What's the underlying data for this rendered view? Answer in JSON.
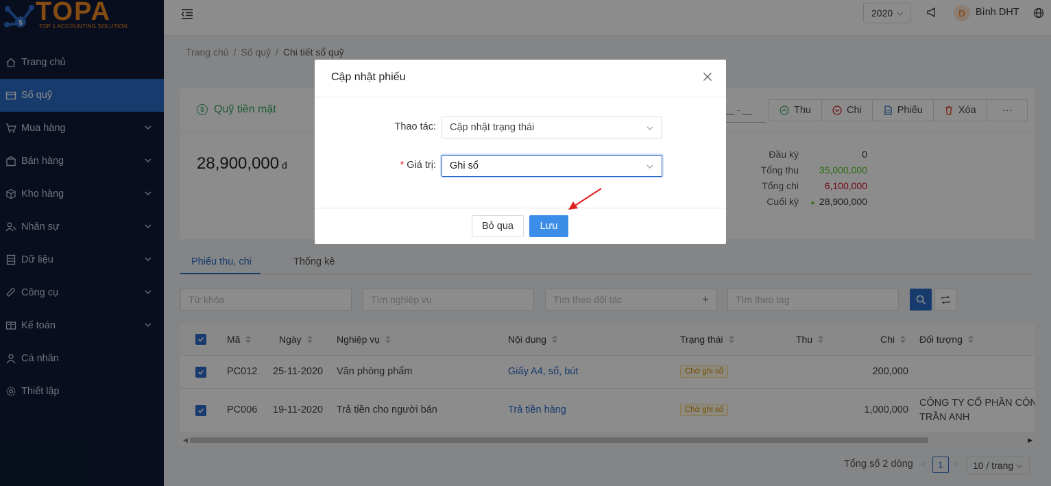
{
  "brand": {
    "name": "TOPA",
    "tagline": "TOP 1 ACCOUNTING SOLUTION",
    "color": "#f08a24"
  },
  "sidebar": {
    "items": [
      {
        "label": "Trang chủ",
        "icon": "home-icon",
        "expandable": false,
        "active": false
      },
      {
        "label": "Sổ quỹ",
        "icon": "wallet-icon",
        "expandable": false,
        "active": true
      },
      {
        "label": "Mua hàng",
        "icon": "cart-icon",
        "expandable": true,
        "active": false
      },
      {
        "label": "Bán hàng",
        "icon": "bag-icon",
        "expandable": true,
        "active": false
      },
      {
        "label": "Kho hàng",
        "icon": "box-icon",
        "expandable": true,
        "active": false
      },
      {
        "label": "Nhân sự",
        "icon": "people-icon",
        "expandable": true,
        "active": false
      },
      {
        "label": "Dữ liệu",
        "icon": "database-icon",
        "expandable": true,
        "active": false
      },
      {
        "label": "Công cụ",
        "icon": "tool-icon",
        "expandable": true,
        "active": false
      },
      {
        "label": "Kế toán",
        "icon": "ledger-icon",
        "expandable": true,
        "active": false
      },
      {
        "label": "Cá nhân",
        "icon": "user-icon",
        "expandable": false,
        "active": false
      },
      {
        "label": "Thiết lập",
        "icon": "gear-icon",
        "expandable": false,
        "active": false
      }
    ]
  },
  "header": {
    "year": "2020",
    "avatar_initial": "D",
    "username": "Bình DHT"
  },
  "breadcrumb": {
    "items": [
      "Trang chủ",
      "Sổ quỹ",
      "Chi tiết sổ quỹ"
    ]
  },
  "fund": {
    "title": "Quỹ tiền mặt",
    "date_fragment": "__ - __",
    "actions": [
      {
        "label": "Thu",
        "icon": "arrow-up-circle-icon"
      },
      {
        "label": "Chi",
        "icon": "arrow-down-circle-icon"
      },
      {
        "label": "Phiếu",
        "icon": "document-icon"
      },
      {
        "label": "Xóa",
        "icon": "trash-icon"
      },
      {
        "label": "···",
        "icon": "more-icon"
      }
    ],
    "balance": "28,900,000",
    "currency": "đ",
    "stats": [
      {
        "label": "Đầu kỳ",
        "value": "0",
        "tone": "default"
      },
      {
        "label": "Tổng thu",
        "value": "35,000,000",
        "tone": "green"
      },
      {
        "label": "Tổng chi",
        "value": "6,100,000",
        "tone": "red"
      },
      {
        "label": "Cuối kỳ",
        "value": "28,900,000",
        "tone": "up"
      }
    ]
  },
  "tabs": [
    "Phiếu thu, chi",
    "Thống kê"
  ],
  "filters": {
    "keyword_placeholder": "Từ khóa",
    "operation_placeholder": "Tìm nghiệp vụ",
    "partner_placeholder": "Tìm theo đối tác",
    "tag_placeholder": "Tìm theo tag"
  },
  "table": {
    "columns": [
      "Mã",
      "Ngày",
      "Nghiệp vụ",
      "Nội dung",
      "Trạng thái",
      "Thu",
      "Chi",
      "Đối tượng"
    ],
    "rows": [
      {
        "code": "PC012",
        "date": "25-11-2020",
        "operation": "Văn phòng phẩm",
        "content": "Giấy A4, sổ, bút",
        "status": "Chờ ghi sổ",
        "income": "",
        "expense": "200,000",
        "party_line1": "",
        "party_line2": ""
      },
      {
        "code": "PC006",
        "date": "19-11-2020",
        "operation": "Trả tiền cho người bán",
        "content": "Trả tiền hàng",
        "status": "Chờ ghi sổ",
        "income": "",
        "expense": "1,000,000",
        "party_line1": "CÔNG TY CỔ PHẦN CÔNG",
        "party_line2": "TRẦN ANH"
      }
    ]
  },
  "pagination": {
    "total": "Tổng số 2 dòng",
    "current_page": "1",
    "page_size": "10 / trang"
  },
  "modal": {
    "title": "Cập nhật phiếu",
    "action_label": "Thao tác",
    "action_value": "Cập nhật trạng thái",
    "value_label": "Giá trị",
    "value_value": "Ghi sổ",
    "cancel_label": "Bỏ qua",
    "save_label": "Lưu"
  },
  "colors": {
    "primary": "#2b6cc7",
    "sidebar_bg": "#0f1b35",
    "green": "#52c41a",
    "red": "#cf1322",
    "annotation_arrow": "#e02020"
  }
}
